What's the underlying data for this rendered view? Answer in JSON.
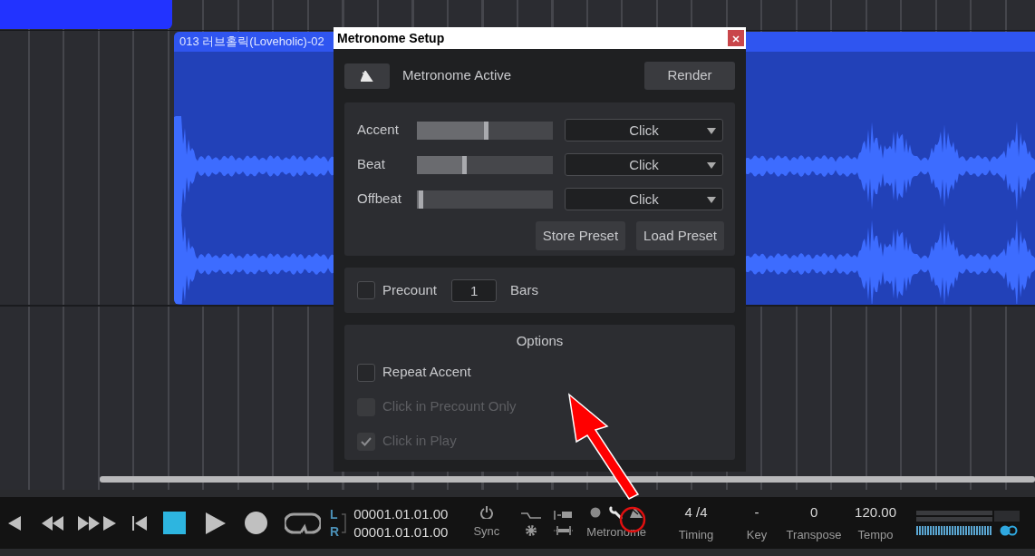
{
  "arrangement": {
    "clip": {
      "title": "013 러브홀릭(Loveholic)-02"
    }
  },
  "dialog": {
    "title": "Metronome Setup",
    "active_label": "Metronome Active",
    "render": "Render",
    "sounds": [
      {
        "name": "Accent",
        "level": 0.5,
        "sound": "Click"
      },
      {
        "name": "Beat",
        "level": 0.34,
        "sound": "Click"
      },
      {
        "name": "Offbeat",
        "level": 0.02,
        "sound": "Click"
      }
    ],
    "preset_buttons": [
      "Store Preset",
      "Load Preset"
    ],
    "precount": {
      "label": "Precount",
      "checked": false,
      "value": "1",
      "unit": "Bars"
    },
    "options": {
      "title": "Options",
      "items": [
        {
          "label": "Repeat Accent",
          "checked": false,
          "disabled": false
        },
        {
          "label": "Click in Precount Only",
          "checked": false,
          "disabled": true
        },
        {
          "label": "Click in Play",
          "checked": true,
          "disabled": true
        }
      ]
    }
  },
  "transport": {
    "locators": [
      {
        "label": "L",
        "time": "00001.01.01.00"
      },
      {
        "label": "R",
        "time": "00001.01.01.00"
      }
    ],
    "sync": "Sync",
    "metronome": "Metronome",
    "fields": [
      {
        "value": "4 /4",
        "label": "Timing"
      },
      {
        "value": "-",
        "label": "Key"
      },
      {
        "value": "0",
        "label": "Transpose"
      },
      {
        "value": "120.00",
        "label": "Tempo"
      }
    ]
  }
}
